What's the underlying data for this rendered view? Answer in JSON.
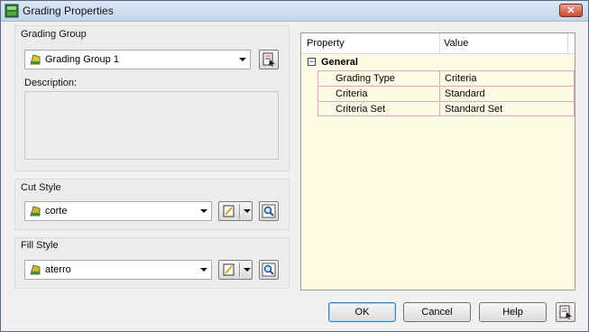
{
  "window": {
    "title": "Grading Properties",
    "close_label": "✕"
  },
  "grading_group": {
    "label": "Grading Group",
    "selected": "Grading Group 1",
    "description_label": "Description:",
    "description_value": ""
  },
  "cut_style": {
    "label": "Cut Style",
    "selected": "corte"
  },
  "fill_style": {
    "label": "Fill Style",
    "selected": "aterro"
  },
  "properties": {
    "columns": [
      "Property",
      "Value"
    ],
    "category": "General",
    "rows": [
      {
        "property": "Grading Type",
        "value": "Criteria"
      },
      {
        "property": "Criteria",
        "value": "Standard"
      },
      {
        "property": "Criteria Set",
        "value": "Standard Set"
      }
    ]
  },
  "buttons": {
    "ok": "OK",
    "cancel": "Cancel",
    "help": "Help"
  },
  "icons": {
    "app": "grading-app-icon",
    "group_pick": "pick-from-drawing-icon",
    "edit_style": "edit-style-icon",
    "view_style": "magnifier-icon",
    "help_pick": "pick-help-icon"
  }
}
